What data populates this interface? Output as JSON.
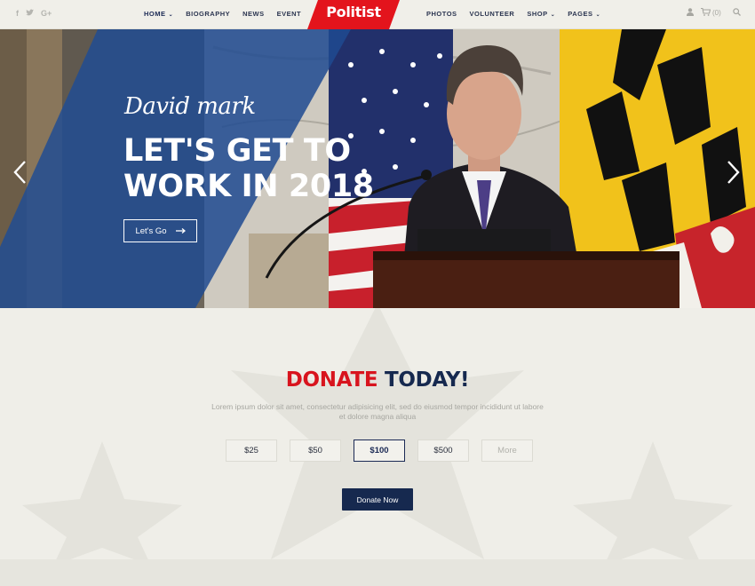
{
  "header": {
    "social": [
      "f",
      "t",
      "G+"
    ],
    "nav_left": [
      {
        "label": "HOME",
        "dropdown": true
      },
      {
        "label": "BIOGRAPHY",
        "dropdown": false
      },
      {
        "label": "NEWS",
        "dropdown": false
      },
      {
        "label": "EVENT",
        "dropdown": false
      }
    ],
    "logo": "Politist",
    "nav_right": [
      {
        "label": "PHOTOS",
        "dropdown": false
      },
      {
        "label": "VOLUNTEER",
        "dropdown": false
      },
      {
        "label": "SHOP",
        "dropdown": true
      },
      {
        "label": "PAGES",
        "dropdown": true
      }
    ],
    "cart_count": "(0)",
    "icons": [
      "user-icon",
      "cart-icon",
      "search-icon"
    ]
  },
  "hero": {
    "script_name": "David mark",
    "title": "LET'S GET TO WORK IN 2018",
    "button_label": "Let's Go",
    "prev_icon": "chevron-left-icon",
    "next_icon": "chevron-right-icon"
  },
  "donate": {
    "title_red": "DONATE",
    "title_blue": "TODAY!",
    "description": "Lorem ipsum dolor sit amet, consectetur adipisicing elit, sed do eiusmod tempor incididunt ut labore et dolore magna aliqua",
    "amounts": [
      "$25",
      "$50",
      "$100",
      "$500",
      "More"
    ],
    "selected_amount": "$100",
    "button_label": "Donate Now"
  },
  "colors": {
    "accent_red": "#d8141e",
    "navy": "#16294f",
    "background": "#efeee8"
  }
}
